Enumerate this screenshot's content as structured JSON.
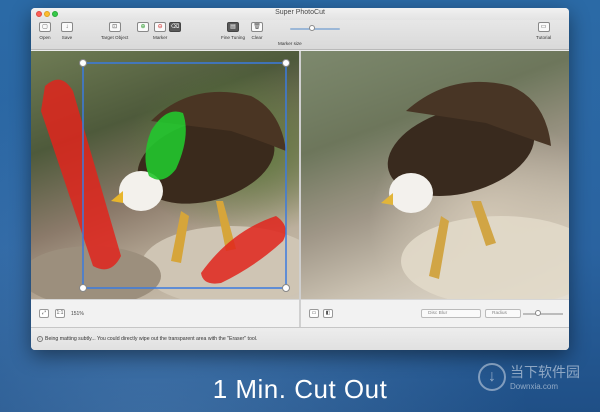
{
  "window": {
    "title": "Super PhotoCut"
  },
  "toolbar": {
    "open": {
      "label": "Open",
      "icon": "folder-icon"
    },
    "save": {
      "label": "Save",
      "icon": "save-icon"
    },
    "target_object": {
      "label": "Target Object",
      "icon": "target-icon"
    },
    "marker": {
      "label": "Marker",
      "icons": [
        "plus-marker-icon",
        "minus-marker-icon",
        "eraser-icon"
      ]
    },
    "fine_tuning": {
      "label": "Fine Tuning",
      "icon": "fine-tuning-icon"
    },
    "clear": {
      "label": "Clear",
      "icon": "trash-icon"
    },
    "marker_size": {
      "label": "Marker size"
    },
    "tutorial": {
      "label": "Tutorial",
      "icon": "tutorial-icon"
    }
  },
  "left_pane": {
    "zoom_label": "151%",
    "marks": [
      {
        "name": "red-background-mark-left",
        "color": "#e0251c"
      },
      {
        "name": "green-foreground-mark",
        "color": "#22c72e"
      },
      {
        "name": "red-background-mark-bottom",
        "color": "#e0251c"
      }
    ],
    "selection_color": "#3b7be0"
  },
  "right_pane": {
    "blur_select": "Disc Blur",
    "radius_select": "Radius"
  },
  "status": {
    "text": "Being matting subtly... You could directly wipe out the transparent area with the \"Eraser\" tool."
  },
  "caption": "1 Min. Cut Out",
  "watermark": {
    "cn": "当下软件园",
    "en": "Downxia.com"
  }
}
